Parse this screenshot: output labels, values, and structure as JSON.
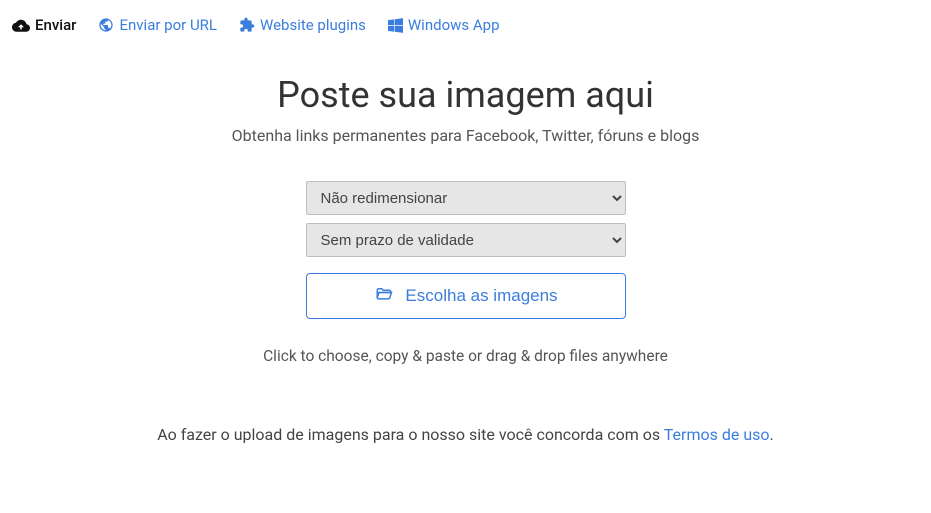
{
  "nav": {
    "upload": "Enviar",
    "byUrl": "Enviar por URL",
    "plugins": "Website plugins",
    "windowsApp": "Windows App"
  },
  "main": {
    "title": "Poste sua imagem aqui",
    "subtitle": "Obtenha links permanentes para Facebook, Twitter, fóruns e blogs",
    "resizeSelected": "Não redimensionar",
    "expirySelected": "Sem prazo de validade",
    "chooseButton": "Escolha as imagens",
    "instructions": "Click to choose, copy & paste or drag & drop files anywhere"
  },
  "terms": {
    "prefix": "Ao fazer o upload de imagens para o nosso site você concorda com os ",
    "linkText": "Termos de uso",
    "suffix": "."
  }
}
